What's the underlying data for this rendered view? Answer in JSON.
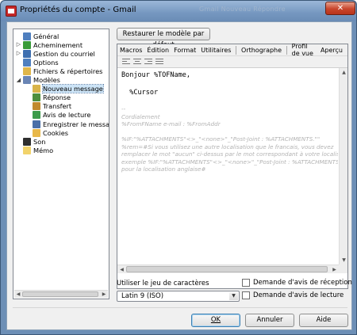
{
  "window": {
    "title": "Propriétés du compte - Gmail",
    "ghost_title": "Gmail   Nouveau   Répondre",
    "close_glyph": "✕",
    "accent": "#6d8fb6"
  },
  "tree": {
    "items": [
      {
        "label": "Général",
        "icon": "general-icon",
        "expander": "",
        "color": "#4f7fbf"
      },
      {
        "label": "Acheminement",
        "icon": "routing-icon",
        "expander": "▷",
        "color": "#3a9b3a"
      },
      {
        "label": "Gestion du courriel",
        "icon": "mail-management-icon",
        "expander": "▷",
        "color": "#3e6fb0"
      },
      {
        "label": "Options",
        "icon": "options-icon",
        "expander": "",
        "color": "#4f7fbf"
      },
      {
        "label": "Fichiers & répertoires",
        "icon": "folder-icon",
        "expander": "",
        "color": "#e0b64a"
      },
      {
        "label": "Modèles",
        "icon": "templates-icon",
        "expander": "◢",
        "color": "#6a85b5"
      },
      {
        "label": "Nouveau message",
        "icon": "new-message-icon",
        "expander": "",
        "color": "#d9b44a",
        "selected": true
      },
      {
        "label": "Réponse",
        "icon": "reply-icon",
        "expander": "",
        "color": "#4e8f3e"
      },
      {
        "label": "Transfert",
        "icon": "forward-icon",
        "expander": "",
        "color": "#c08a2e"
      },
      {
        "label": "Avis de lecture",
        "icon": "read-receipt-icon",
        "expander": "",
        "color": "#3c9a4a"
      },
      {
        "label": "Enregistrer le message",
        "icon": "save-message-icon",
        "expander": "",
        "color": "#4a6fa8"
      },
      {
        "label": "Cookies",
        "icon": "cookie-icon",
        "expander": "",
        "color": "#e8b84a"
      },
      {
        "label": "Son",
        "icon": "sound-icon",
        "expander": "",
        "color": "#2f2f2f"
      },
      {
        "label": "Mémo",
        "icon": "memo-icon",
        "expander": "",
        "color": "#f2d36b"
      }
    ]
  },
  "restore_button": "Restaurer le modèle par défaut",
  "editor": {
    "menu": [
      "Macros",
      "Édition",
      "Format",
      "Utilitaires",
      "Orthographe",
      "Profil de vue",
      "Aperçu"
    ],
    "lines": [
      "Bonjour %TOFName,",
      "",
      "  %Cursor"
    ],
    "faded_lines": [
      "--",
      "Cordialement",
      " %FromFName                    e-mail : %FromAddr",
      "",
      "%IF:\"%ATTACHMENTS\"<>_\"<none>\"_\"Post-Joint : %ATTACHMENTS.\"\"",
      "%rem=#Si vous utilisez une autre localisation que le francais, vous devez",
      " remplacer le mot \"aucun\" ci-dessus par le mot correspondant à votre localisation,",
      "exemple %IF:\"%ATTACHMENTS\"<>_\"<none>\"_\"Post-Joint : %ATTACHMENTS.\"\"",
      "pour la localisation anglaise#"
    ]
  },
  "charset": {
    "label": "Utiliser le jeu de caractères",
    "value": "Latin 9 (ISO)"
  },
  "checkboxes": {
    "receipt_request": "Demande d'avis de réception",
    "read_request": "Demande d'avis de lecture"
  },
  "buttons": {
    "ok": "OK",
    "cancel": "Annuler",
    "help": "Aide"
  }
}
